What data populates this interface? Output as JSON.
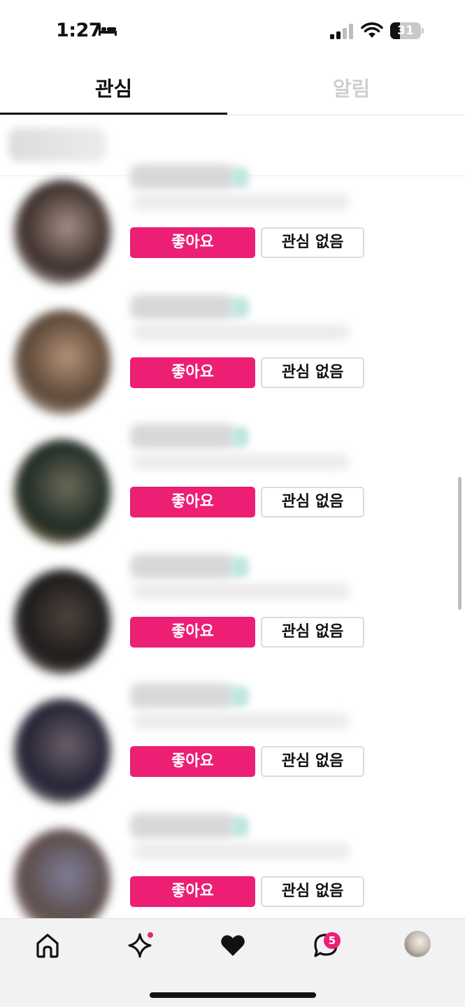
{
  "status_bar": {
    "time": "1:27",
    "battery": "31",
    "battery_percent": 31
  },
  "tabs": [
    {
      "label": "관심",
      "active": true
    },
    {
      "label": "알림",
      "active": false
    }
  ],
  "items": [
    {
      "like_label": "좋아요",
      "pass_label": "관심 없음",
      "avatar_colors": [
        "#3b2e2a",
        "#a58f86",
        "#e7dfdd"
      ]
    },
    {
      "like_label": "좋아요",
      "pass_label": "관심 없음",
      "avatar_colors": [
        "#5a4636",
        "#b59278",
        "#e8ddd7"
      ]
    },
    {
      "like_label": "좋아요",
      "pass_label": "관심 없음",
      "avatar_colors": [
        "#1d2a24",
        "#6d6a58",
        "#c9a36c"
      ]
    },
    {
      "like_label": "좋아요",
      "pass_label": "관심 없음",
      "avatar_colors": [
        "#1b1b1b",
        "#4e423b",
        "#a18f86"
      ]
    },
    {
      "like_label": "좋아요",
      "pass_label": "관심 없음",
      "avatar_colors": [
        "#222233",
        "#6c5f6a",
        "#b8a7a8"
      ]
    },
    {
      "like_label": "좋아요",
      "pass_label": "관심 없음",
      "avatar_colors": [
        "#5d4c4a",
        "#7d7e96",
        "#c8b9b5"
      ]
    }
  ],
  "nav": {
    "chat_badge": "5",
    "items": [
      "home-icon",
      "sparkle-icon",
      "heart-icon",
      "chat-icon",
      "profile-avatar"
    ]
  },
  "colors": {
    "accent": "#ec1f75",
    "inactive_tab": "#cfcfcf"
  }
}
